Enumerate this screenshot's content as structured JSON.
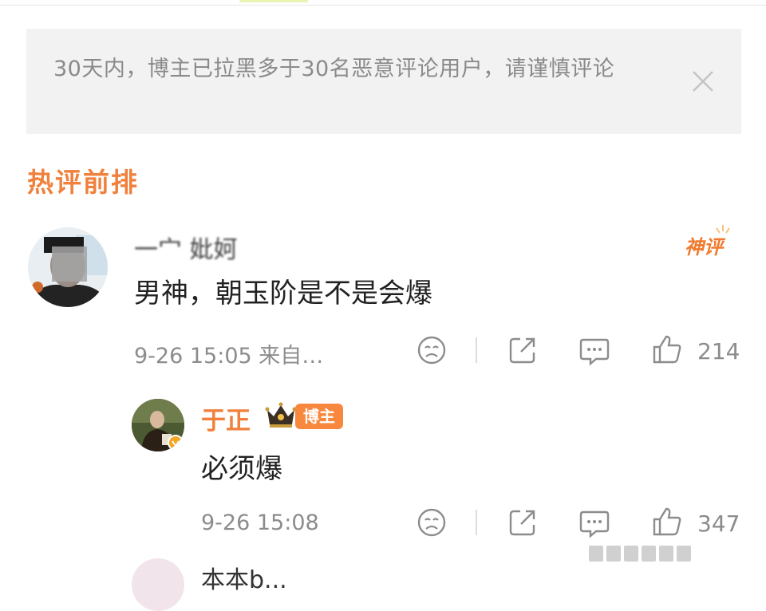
{
  "notice": {
    "text": "30天内，博主已拉黑多于30名恶意评论用户，请谨慎评论"
  },
  "section": {
    "title": "热评前排"
  },
  "comment": {
    "username": "一宀 妣妸",
    "text": "男神，朝玉阶是不是会爆",
    "badge": "神评",
    "meta": "9-26 15:05 来自…",
    "like_count": "214"
  },
  "reply": {
    "username": "于正",
    "tag": "博主",
    "text": "必须爆",
    "meta": "9-26 15:08",
    "like_count": "347"
  },
  "next_comment": {
    "username": "本本b..."
  },
  "colors": {
    "accent": "#f0803c",
    "notice_bg": "#f2f2f2",
    "meta_text": "#8c8c8c"
  },
  "icons": [
    "close-icon",
    "dislike-icon",
    "share-icon",
    "comment-icon",
    "like-icon",
    "crown-icon",
    "verified-icon"
  ]
}
